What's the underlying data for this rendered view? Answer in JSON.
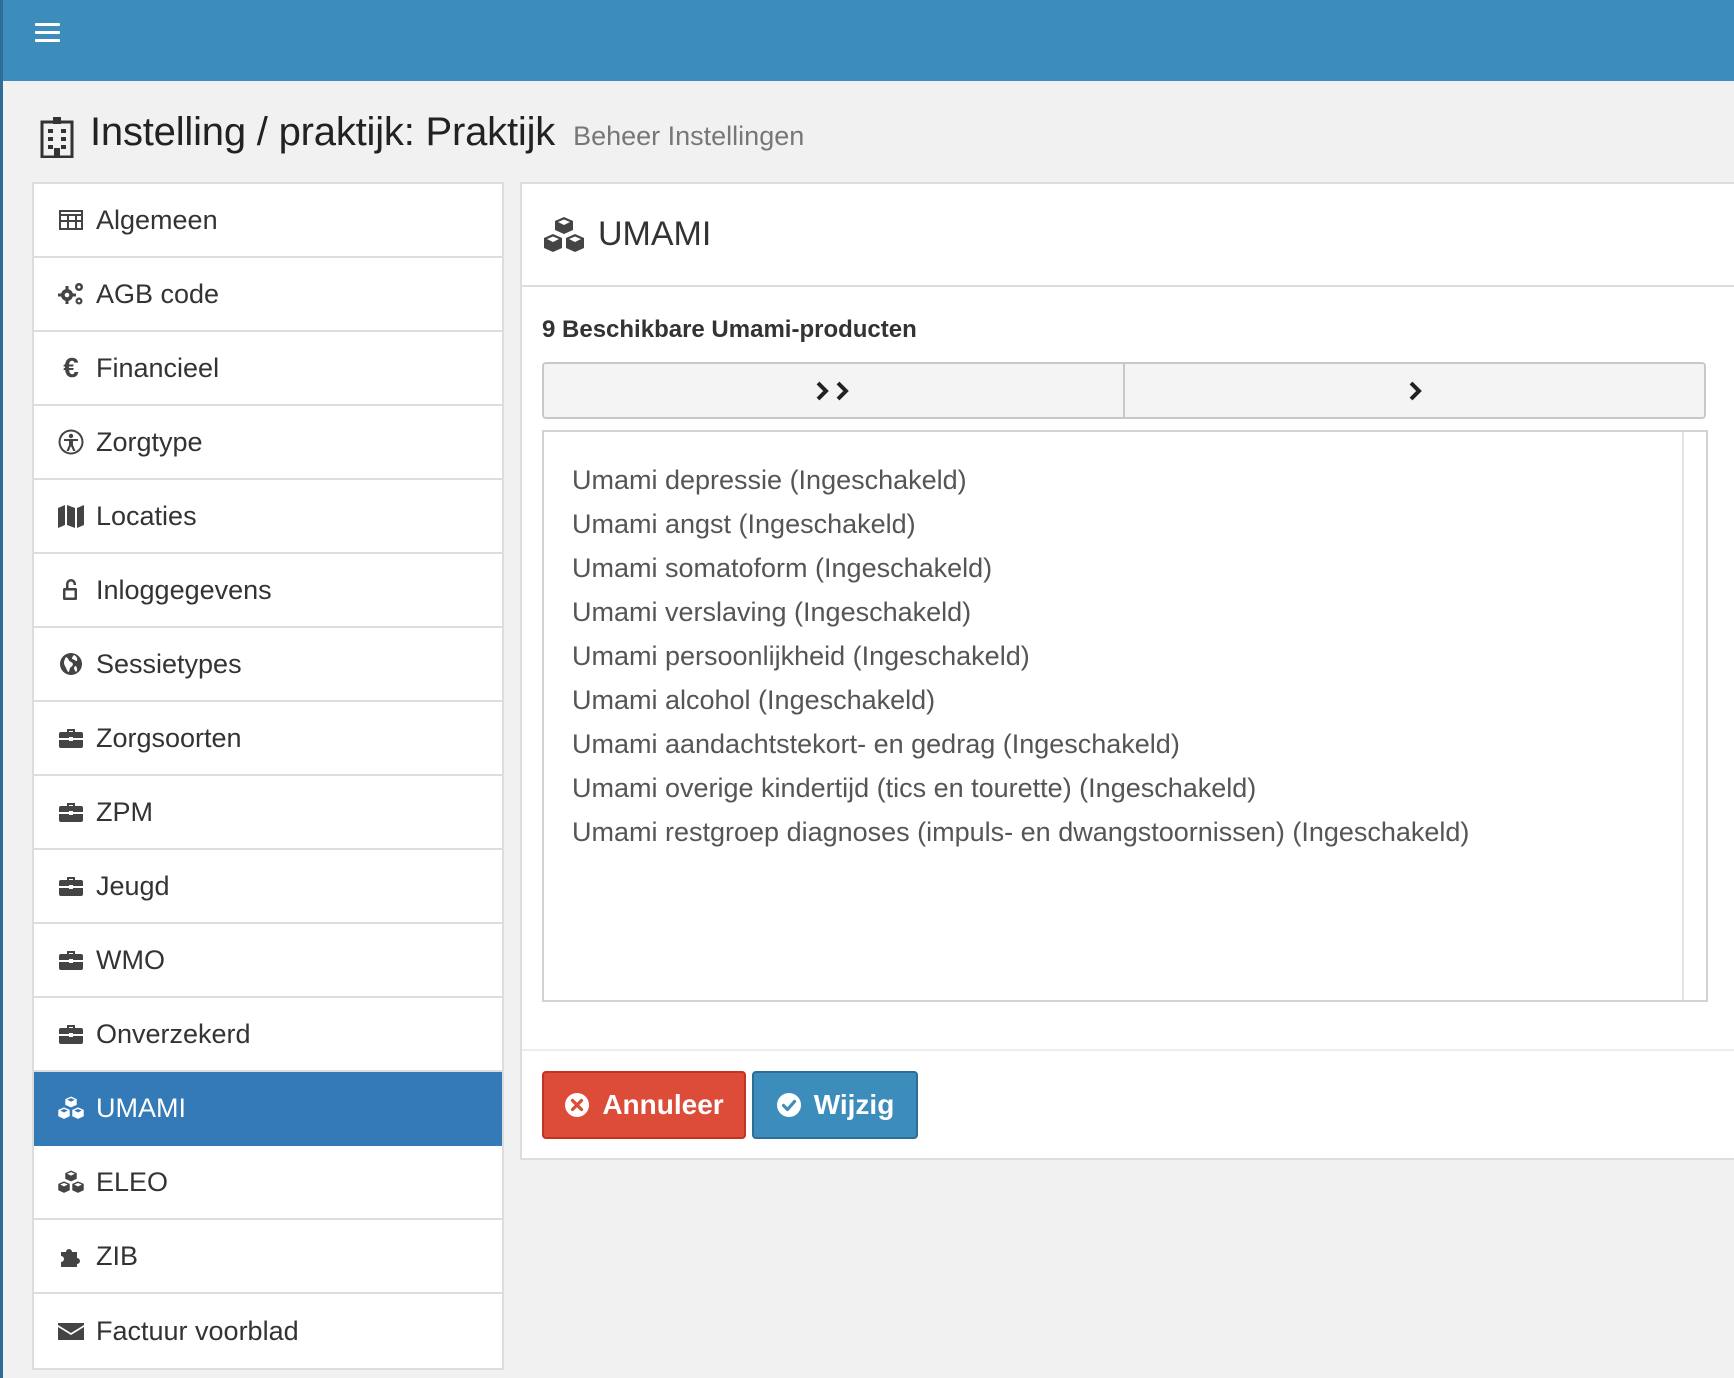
{
  "header": {
    "title": "Instelling / praktijk: Praktijk",
    "subtitle": "Beheer Instellingen"
  },
  "sidebar": {
    "items": [
      {
        "label": "Algemeen",
        "icon": "table-icon"
      },
      {
        "label": "AGB code",
        "icon": "cogs-icon"
      },
      {
        "label": "Financieel",
        "icon": "euro-icon",
        "glyph": "€"
      },
      {
        "label": "Zorgtype",
        "icon": "accessibility-icon"
      },
      {
        "label": "Locaties",
        "icon": "map-icon"
      },
      {
        "label": "Inloggegevens",
        "icon": "unlock-icon"
      },
      {
        "label": "Sessietypes",
        "icon": "globe-icon"
      },
      {
        "label": "Zorgsoorten",
        "icon": "briefcase-icon"
      },
      {
        "label": "ZPM",
        "icon": "briefcase-icon"
      },
      {
        "label": "Jeugd",
        "icon": "briefcase-icon"
      },
      {
        "label": "WMO",
        "icon": "briefcase-icon"
      },
      {
        "label": "Onverzekerd",
        "icon": "briefcase-icon"
      },
      {
        "label": "UMAMI",
        "icon": "cubes-icon",
        "active": true
      },
      {
        "label": "ELEO",
        "icon": "cubes-icon"
      },
      {
        "label": "ZIB",
        "icon": "puzzle-icon"
      },
      {
        "label": "Factuur voorblad",
        "icon": "envelope-icon"
      }
    ]
  },
  "panel": {
    "title": "UMAMI",
    "available_label": "9 Beschikbare Umami-producten",
    "products": [
      "Umami depressie (Ingeschakeld)",
      "Umami angst (Ingeschakeld)",
      "Umami somatoform (Ingeschakeld)",
      "Umami verslaving (Ingeschakeld)",
      "Umami persoonlijkheid (Ingeschakeld)",
      "Umami alcohol (Ingeschakeld)",
      "Umami aandachtstekort- en gedrag (Ingeschakeld)",
      "Umami overige kindertijd (tics en tourette) (Ingeschakeld)",
      "Umami restgroep diagnoses (impuls- en dwangstoornissen) (Ingeschakeld)"
    ],
    "cancel_label": "Annuleer",
    "save_label": "Wijzig"
  },
  "colors": {
    "topbar": "#3c8dbc",
    "active_item": "#337ab7",
    "cancel": "#dd4b39",
    "save": "#3c8dbc"
  }
}
